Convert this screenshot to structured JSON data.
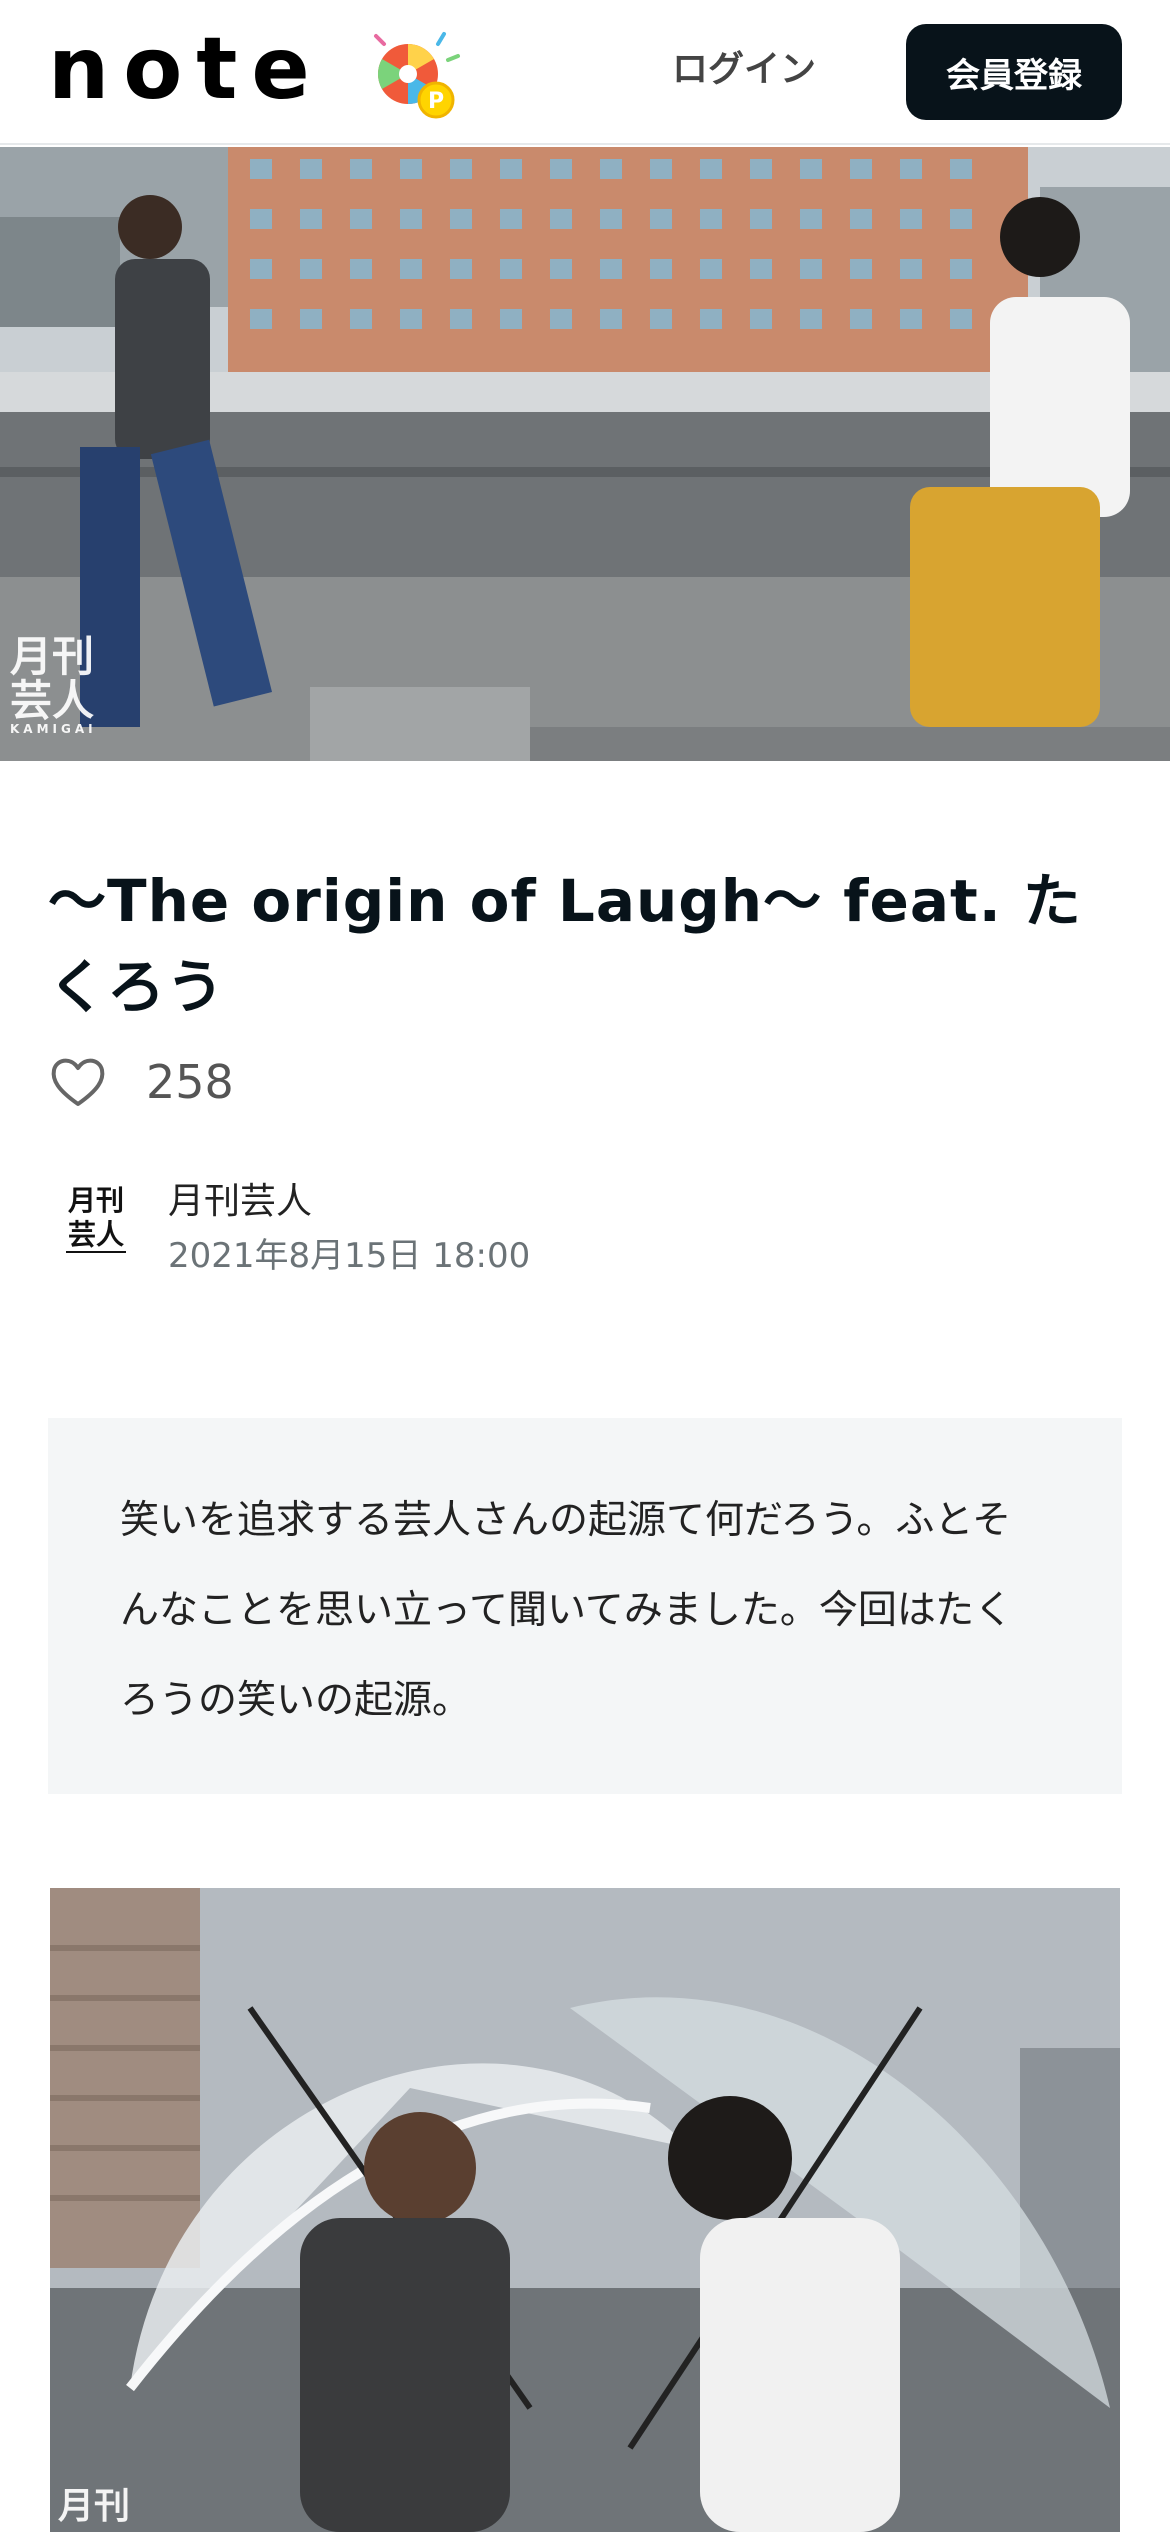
{
  "header": {
    "logo": "note",
    "login_label": "ログイン",
    "signup_label": "会員登録"
  },
  "hero": {
    "watermark_line1": "月刊",
    "watermark_line2": "芸人",
    "watermark_sub": "KAMIGAI"
  },
  "article": {
    "title": "〜The origin of Laugh〜 feat. たくろう",
    "like_count": "258",
    "author": {
      "name": "月刊芸人",
      "avatar_line1": "月刊",
      "avatar_line2": "芸人"
    },
    "date": "2021年8月15日 18:00",
    "summary": "笑いを追求する芸人さんの起源て何だろう。ふとそんなことを思い立って聞いてみました。今回はたくろうの笑いの起源。"
  },
  "photo2": {
    "watermark": "月刊"
  },
  "colors": {
    "text": "#08131a",
    "button_bg": "#08131a",
    "summary_bg": "#f4f6f7"
  }
}
